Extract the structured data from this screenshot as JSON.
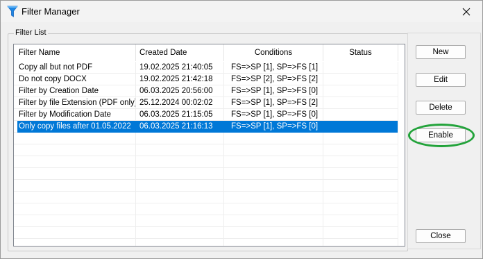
{
  "window": {
    "title": "Filter Manager"
  },
  "group": {
    "label": "Filter List"
  },
  "columns": [
    "Filter Name",
    "Created Date",
    "Conditions",
    "Status"
  ],
  "rows": [
    {
      "name": "Copy all but not PDF",
      "created": "19.02.2025 21:40:05",
      "conditions": "FS=>SP [1], SP=>FS [1]",
      "status": ""
    },
    {
      "name": "Do not copy DOCX",
      "created": "19.02.2025 21:42:18",
      "conditions": "FS=>SP [2], SP=>FS [2]",
      "status": ""
    },
    {
      "name": "Filter by Creation Date",
      "created": "06.03.2025 20:56:00",
      "conditions": "FS=>SP [1], SP=>FS [0]",
      "status": ""
    },
    {
      "name": "Filter by file Extension (PDF only)",
      "created": "25.12.2024 00:02:02",
      "conditions": "FS=>SP [1], SP=>FS [2]",
      "status": ""
    },
    {
      "name": "Filter by Modification Date",
      "created": "06.03.2025 21:15:05",
      "conditions": "FS=>SP [1], SP=>FS [0]",
      "status": ""
    },
    {
      "name": "Only copy files after 01.05.2022",
      "created": "06.03.2025 21:16:13",
      "conditions": "FS=>SP [1], SP=>FS [0]",
      "status": ""
    }
  ],
  "selected_row": 5,
  "buttons": {
    "new": "New",
    "edit": "Edit",
    "delete": "Delete",
    "enable": "Enable",
    "close": "Close"
  },
  "colors": {
    "selection": "#0078d7",
    "highlight_ellipse": "#22a33a",
    "title_icon": "#1e88e5"
  }
}
